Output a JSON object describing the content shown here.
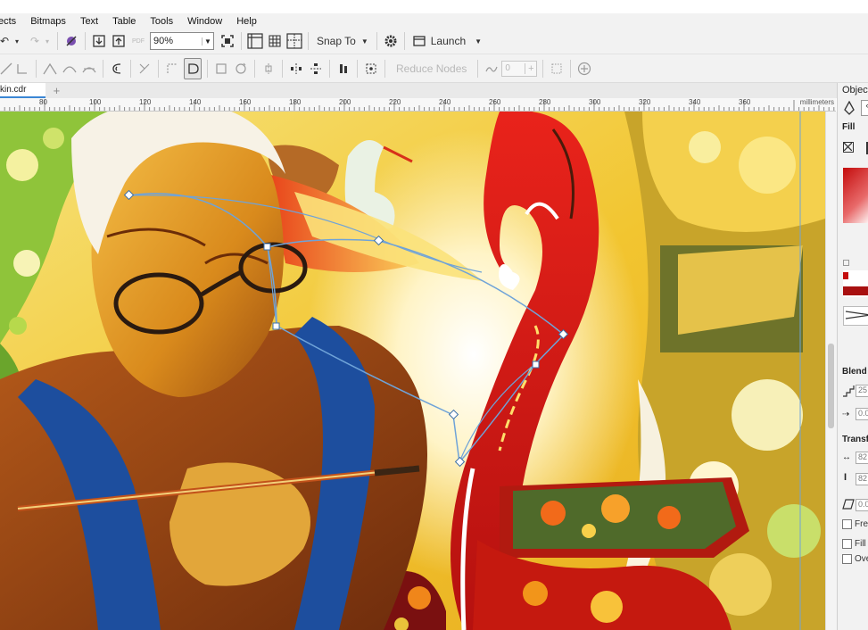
{
  "menu": [
    "ects",
    "Bitmaps",
    "Text",
    "Table",
    "Tools",
    "Window",
    "Help"
  ],
  "toolbar": {
    "zoom_value": "90%",
    "snap_to_label": "Snap To",
    "launch_label": "Launch",
    "reduce_nodes_label": "Reduce Nodes",
    "node_count": "0",
    "pdf_label": "PDF"
  },
  "document": {
    "tab_title": "kin.cdr"
  },
  "ruler": {
    "ticks": [
      "80",
      "100",
      "120",
      "140",
      "160",
      "180",
      "200",
      "220",
      "240",
      "260",
      "280",
      "300",
      "320",
      "340",
      "360"
    ],
    "unit": "millimeters"
  },
  "panel": {
    "title": "Object",
    "fill_label": "Fill",
    "blend_label": "Blend",
    "blend_value_1": "25",
    "blend_value_2": "0.0",
    "transform_label": "Transf",
    "transform_w": "82",
    "transform_h": "82",
    "skew_value": "0.0",
    "freeze_label": "Free",
    "fill_check_label": "Fill",
    "overprint_label": "Ove"
  },
  "colors": {
    "accent_blue": "#3a86d4",
    "fill_red": "#c40d0d",
    "canvas_yellow": "#f3d25a"
  }
}
